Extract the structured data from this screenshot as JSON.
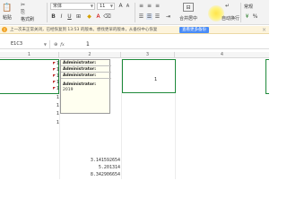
{
  "ribbon": {
    "paste_label": "粘贴",
    "format_painter_label": "格式刷",
    "font_name": "宋体",
    "font_size": "11",
    "merge_label": "合并居中",
    "wrap_label": "自动换行",
    "number_format": "常规"
  },
  "notification": {
    "message": "上一次未正常关闭，已经恢复到 13:53 的版本。想找更早的版本，从备份中心恢复",
    "action_label": "查看更多备份"
  },
  "formula_bar": {
    "name_box": "E1C3",
    "value": "1"
  },
  "columns": [
    "1",
    "2",
    "3",
    "4"
  ],
  "notes_cell": {
    "rows": [
      "Administrator:",
      "Administrator:",
      "Administrator:",
      "Administrator:"
    ],
    "extra": "2019"
  },
  "row_values": [
    "1",
    "1",
    "1",
    "1",
    "1",
    "1",
    "1",
    "1",
    "1"
  ],
  "selected_cell_value": "1",
  "pi_values": [
    "3.141592654",
    "5.201314",
    "8.342906654"
  ]
}
